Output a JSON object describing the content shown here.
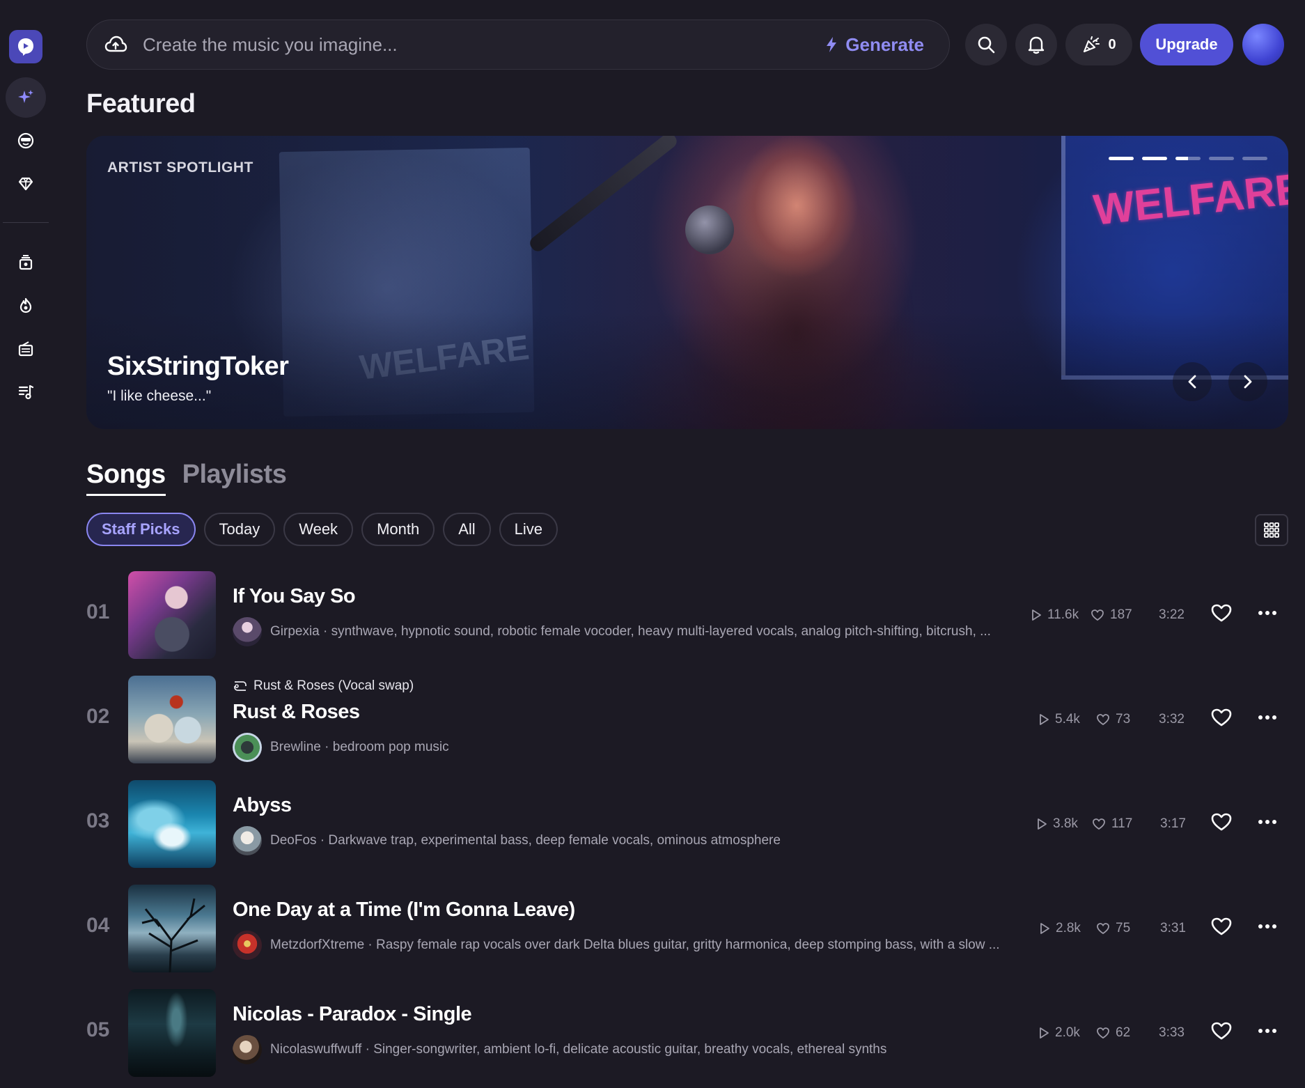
{
  "search": {
    "placeholder": "Create the music you imagine...",
    "generate_label": "Generate"
  },
  "credits": {
    "count": "0"
  },
  "upgrade_label": "Upgrade",
  "featured": {
    "title": "Featured",
    "kicker": "ARTIST SPOTLIGHT",
    "artist": "SixStringToker",
    "quote": "\"I like cheese...\"",
    "slides_total": 5,
    "slide_active": 3
  },
  "tabs": [
    {
      "label": "Songs",
      "active": true
    },
    {
      "label": "Playlists",
      "active": false
    }
  ],
  "filters": [
    {
      "label": "Staff Picks",
      "active": true
    },
    {
      "label": "Today",
      "active": false
    },
    {
      "label": "Week",
      "active": false
    },
    {
      "label": "Month",
      "active": false
    },
    {
      "label": "All",
      "active": false
    },
    {
      "label": "Live",
      "active": false
    }
  ],
  "songs": [
    {
      "rank": "01",
      "title": "If You Say So",
      "remix_of": "",
      "artist": "Girpexia",
      "tags": "synthwave, hypnotic sound, robotic female vocoder, heavy multi-layered vocals, analog pitch-shifting, bitcrush, ...",
      "plays": "11.6k",
      "likes": "187",
      "duration": "3:22"
    },
    {
      "rank": "02",
      "title": "Rust & Roses",
      "remix_of": "Rust & Roses (Vocal swap)",
      "artist": "Brewline",
      "tags": "bedroom pop music",
      "plays": "5.4k",
      "likes": "73",
      "duration": "3:32"
    },
    {
      "rank": "03",
      "title": "Abyss",
      "remix_of": "",
      "artist": "DeoFos",
      "tags": "Darkwave trap, experimental bass, deep female vocals, ominous atmosphere",
      "plays": "3.8k",
      "likes": "117",
      "duration": "3:17"
    },
    {
      "rank": "04",
      "title": "One Day at a Time (I'm Gonna Leave)",
      "remix_of": "",
      "artist": "MetzdorfXtreme",
      "tags": "Raspy female rap vocals over dark Delta blues guitar, gritty harmonica, deep stomping bass, with a slow ...",
      "plays": "2.8k",
      "likes": "75",
      "duration": "3:31"
    },
    {
      "rank": "05",
      "title": "Nicolas - Paradox - Single",
      "remix_of": "",
      "artist": "Nicolaswuffwuff",
      "tags": "Singer-songwriter, ambient lo-fi, delicate acoustic guitar, breathy vocals, ethereal synths",
      "plays": "2.0k",
      "likes": "62",
      "duration": "3:33"
    }
  ],
  "colors": {
    "accent": "#5150d6",
    "accent_text": "#908cf2",
    "background": "#1c1a24"
  },
  "icons": {
    "sidebar": [
      "sparkle-icon",
      "smiley-icon",
      "gem-icon",
      "library-icon",
      "flame-icon",
      "radio-icon",
      "playlist-icon"
    ],
    "topbar": [
      "cloud-upload-icon",
      "bolt-icon",
      "search-icon",
      "bell-icon",
      "confetti-icon"
    ]
  }
}
